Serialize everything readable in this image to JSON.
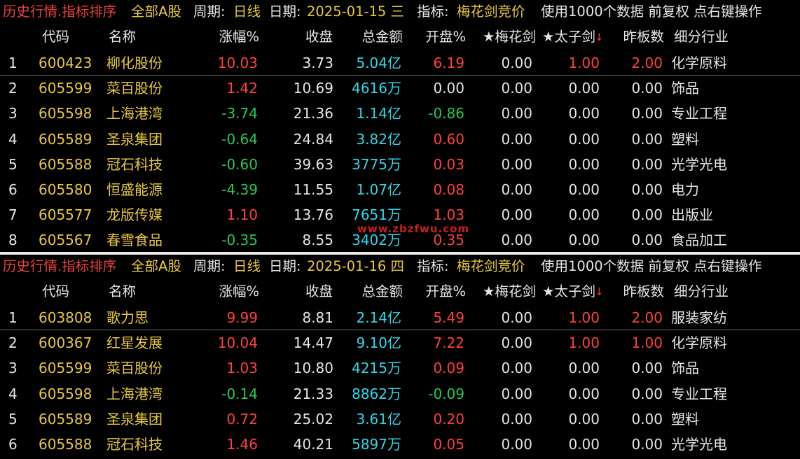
{
  "panels": [
    {
      "title": {
        "mode": "历史行情.指标排序",
        "market": "全部A股",
        "period_label": "周期:",
        "period_value": "日线",
        "date_label": "日期:",
        "date_value": "2025-01-15 三",
        "indicator_label": "指标:",
        "indicator_value": "梅花剑竞价",
        "note": "使用1000个数据 前复权 点右键操作"
      },
      "headers": [
        "代码",
        "名称",
        "涨幅%",
        "收盘",
        "总金额",
        "开盘%",
        "★梅花剑",
        "★太子剑",
        "昨板数",
        "细分行业"
      ],
      "sort_arrow": "↓",
      "rows": [
        {
          "idx": "1",
          "code": "600423",
          "name": "柳化股份",
          "chg": "10.03",
          "close": "3.73",
          "amount": "5.04亿",
          "open": "6.19",
          "mhj": "0.00",
          "tzj": "1.00",
          "zbs": "2.00",
          "industry": "化学原料",
          "chg_dir": "up",
          "open_dir": "up",
          "tzj_dir": "up",
          "zbs_dir": "up"
        },
        {
          "idx": "2",
          "code": "605599",
          "name": "菜百股份",
          "chg": "1.42",
          "close": "10.69",
          "amount": "4616万",
          "open": "0.00",
          "mhj": "0.00",
          "tzj": "0.00",
          "zbs": "0.00",
          "industry": "饰品",
          "chg_dir": "up",
          "open_dir": "flat",
          "tzj_dir": "flat",
          "zbs_dir": "flat"
        },
        {
          "idx": "3",
          "code": "605598",
          "name": "上海港湾",
          "chg": "-3.74",
          "close": "21.36",
          "amount": "1.14亿",
          "open": "-0.86",
          "mhj": "0.00",
          "tzj": "0.00",
          "zbs": "0.00",
          "industry": "专业工程",
          "chg_dir": "dn",
          "open_dir": "dn",
          "tzj_dir": "flat",
          "zbs_dir": "flat"
        },
        {
          "idx": "4",
          "code": "605589",
          "name": "圣泉集团",
          "chg": "-0.64",
          "close": "24.84",
          "amount": "3.82亿",
          "open": "0.60",
          "mhj": "0.00",
          "tzj": "0.00",
          "zbs": "0.00",
          "industry": "塑料",
          "chg_dir": "dn",
          "open_dir": "up",
          "tzj_dir": "flat",
          "zbs_dir": "flat"
        },
        {
          "idx": "5",
          "code": "605588",
          "name": "冠石科技",
          "chg": "-0.60",
          "close": "39.63",
          "amount": "3775万",
          "open": "0.03",
          "mhj": "0.00",
          "tzj": "0.00",
          "zbs": "0.00",
          "industry": "光学光电",
          "chg_dir": "dn",
          "open_dir": "up",
          "tzj_dir": "flat",
          "zbs_dir": "flat"
        },
        {
          "idx": "6",
          "code": "605580",
          "name": "恒盛能源",
          "chg": "-4.39",
          "close": "11.55",
          "amount": "1.07亿",
          "open": "0.08",
          "mhj": "0.00",
          "tzj": "0.00",
          "zbs": "0.00",
          "industry": "电力",
          "chg_dir": "dn",
          "open_dir": "up",
          "tzj_dir": "flat",
          "zbs_dir": "flat"
        },
        {
          "idx": "7",
          "code": "605577",
          "name": "龙版传媒",
          "chg": "1.10",
          "close": "13.76",
          "amount": "7651万",
          "open": "1.03",
          "mhj": "0.00",
          "tzj": "0.00",
          "zbs": "0.00",
          "industry": "出版业",
          "chg_dir": "up",
          "open_dir": "up",
          "tzj_dir": "flat",
          "zbs_dir": "flat"
        },
        {
          "idx": "8",
          "code": "605567",
          "name": "春雪食品",
          "chg": "-0.35",
          "close": "8.55",
          "amount": "3402万",
          "open": "0.35",
          "mhj": "0.00",
          "tzj": "0.00",
          "zbs": "0.00",
          "industry": "食品加工",
          "chg_dir": "dn",
          "open_dir": "up",
          "tzj_dir": "flat",
          "zbs_dir": "flat"
        }
      ]
    },
    {
      "title": {
        "mode": "历史行情.指标排序",
        "market": "全部A股",
        "period_label": "周期:",
        "period_value": "日线",
        "date_label": "日期:",
        "date_value": "2025-01-16 四",
        "indicator_label": "指标:",
        "indicator_value": "梅花剑竞价",
        "note": "使用1000个数据 前复权 点右键操作"
      },
      "headers": [
        "代码",
        "名称",
        "涨幅%",
        "收盘",
        "总金额",
        "开盘%",
        "★梅花剑",
        "★太子剑",
        "昨板数",
        "细分行业"
      ],
      "sort_arrow": "↓",
      "rows": [
        {
          "idx": "1",
          "code": "603808",
          "name": "歌力思",
          "chg": "9.99",
          "close": "8.81",
          "amount": "2.14亿",
          "open": "5.49",
          "mhj": "0.00",
          "tzj": "1.00",
          "zbs": "2.00",
          "industry": "服装家纺",
          "chg_dir": "up",
          "open_dir": "up",
          "tzj_dir": "up",
          "zbs_dir": "up"
        },
        {
          "idx": "2",
          "code": "600367",
          "name": "红星发展",
          "chg": "10.04",
          "close": "14.47",
          "amount": "9.10亿",
          "open": "7.22",
          "mhj": "0.00",
          "tzj": "1.00",
          "zbs": "1.00",
          "industry": "化学原料",
          "chg_dir": "up",
          "open_dir": "up",
          "tzj_dir": "up",
          "zbs_dir": "up"
        },
        {
          "idx": "3",
          "code": "605599",
          "name": "菜百股份",
          "chg": "1.03",
          "close": "10.80",
          "amount": "4215万",
          "open": "0.09",
          "mhj": "0.00",
          "tzj": "0.00",
          "zbs": "0.00",
          "industry": "饰品",
          "chg_dir": "up",
          "open_dir": "up",
          "tzj_dir": "flat",
          "zbs_dir": "flat"
        },
        {
          "idx": "4",
          "code": "605598",
          "name": "上海港湾",
          "chg": "-0.14",
          "close": "21.33",
          "amount": "8862万",
          "open": "-0.09",
          "mhj": "0.00",
          "tzj": "0.00",
          "zbs": "0.00",
          "industry": "专业工程",
          "chg_dir": "dn",
          "open_dir": "dn",
          "tzj_dir": "flat",
          "zbs_dir": "flat"
        },
        {
          "idx": "5",
          "code": "605589",
          "name": "圣泉集团",
          "chg": "0.72",
          "close": "25.02",
          "amount": "3.61亿",
          "open": "0.20",
          "mhj": "0.00",
          "tzj": "0.00",
          "zbs": "0.00",
          "industry": "塑料",
          "chg_dir": "up",
          "open_dir": "up",
          "tzj_dir": "flat",
          "zbs_dir": "flat"
        },
        {
          "idx": "6",
          "code": "605588",
          "name": "冠石科技",
          "chg": "1.46",
          "close": "40.21",
          "amount": "5897万",
          "open": "0.05",
          "mhj": "0.00",
          "tzj": "0.00",
          "zbs": "0.00",
          "industry": "光学光电",
          "chg_dir": "up",
          "open_dir": "up",
          "tzj_dir": "flat",
          "zbs_dir": "flat"
        }
      ]
    }
  ],
  "watermark": "www.zbzfwu.com",
  "colors": {
    "background": "#000000",
    "title_red": "#e8413c",
    "title_yellow": "#e6c83c",
    "up_red": "#ff4040",
    "down_green": "#22c95a",
    "amount_cyan": "#2fd7e6"
  }
}
